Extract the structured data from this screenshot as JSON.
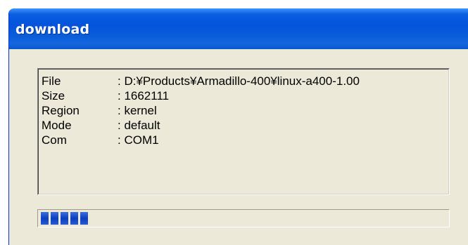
{
  "window": {
    "title": "download"
  },
  "info": {
    "rows": [
      {
        "label": "File",
        "value": ": D:¥Products¥Armadillo-400¥linux-a400-1.00"
      },
      {
        "label": "Size",
        "value": ": 1662111"
      },
      {
        "label": "Region",
        "value": ": kernel"
      },
      {
        "label": "Mode",
        "value": ": default"
      },
      {
        "label": "Com",
        "value": ": COM1"
      }
    ]
  },
  "progress": {
    "fraction": 0.14,
    "chunks": 5,
    "fill_color": "#0a3fc0"
  },
  "colors": {
    "titlebar": "#0553dc",
    "window_face": "#ece9d8"
  }
}
